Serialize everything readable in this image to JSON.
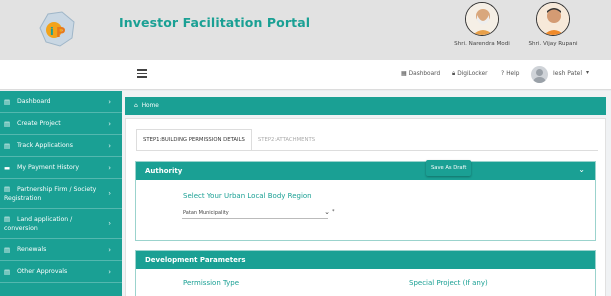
{
  "header": {
    "title": "Investor Facilitation Portal",
    "leaders": [
      {
        "name": "Shri. Narendra Modi"
      },
      {
        "name": "Shri. Vijay Rupani"
      }
    ]
  },
  "navbar": {
    "menu_icon": "hamburger-icon",
    "links": [
      {
        "label": "Dashboard",
        "icon": "dashboard-icon"
      },
      {
        "label": "DigiLocker",
        "icon": "lock-icon"
      },
      {
        "label": "Help",
        "icon": "help-icon"
      }
    ],
    "user": {
      "name": "Iesh Patel"
    }
  },
  "sidebar": {
    "items": [
      {
        "label": "Dashboard"
      },
      {
        "label": "Create Project"
      },
      {
        "label": "Track Applications"
      },
      {
        "label": "My Payment History"
      },
      {
        "label_line1": "Partnership Firm / Society",
        "label_line2": "Registration"
      },
      {
        "label_line1": "Land application /",
        "label_line2": "conversion"
      },
      {
        "label": "Renewals"
      },
      {
        "label": "Other Approvals"
      }
    ]
  },
  "breadcrumb": {
    "home": "Home"
  },
  "tabs": [
    {
      "label": "STEP1:BUILDING PERMISSION DETAILS",
      "active": true
    },
    {
      "label": "STEP2:ATTACHMENTS",
      "active": false
    }
  ],
  "authority": {
    "title": "Authority",
    "region_label": "Select Your Urban Local Body Region",
    "region_value": "Patan Municipality",
    "required_mark": "*"
  },
  "development": {
    "title": "Development Parameters",
    "permission_type_label": "Permission Type",
    "special_project_label": "Special Project (If any)"
  },
  "save_draft_label": "Save As Draft",
  "colors": {
    "accent": "#1aa094",
    "header_bg": "#e2e2e2"
  }
}
